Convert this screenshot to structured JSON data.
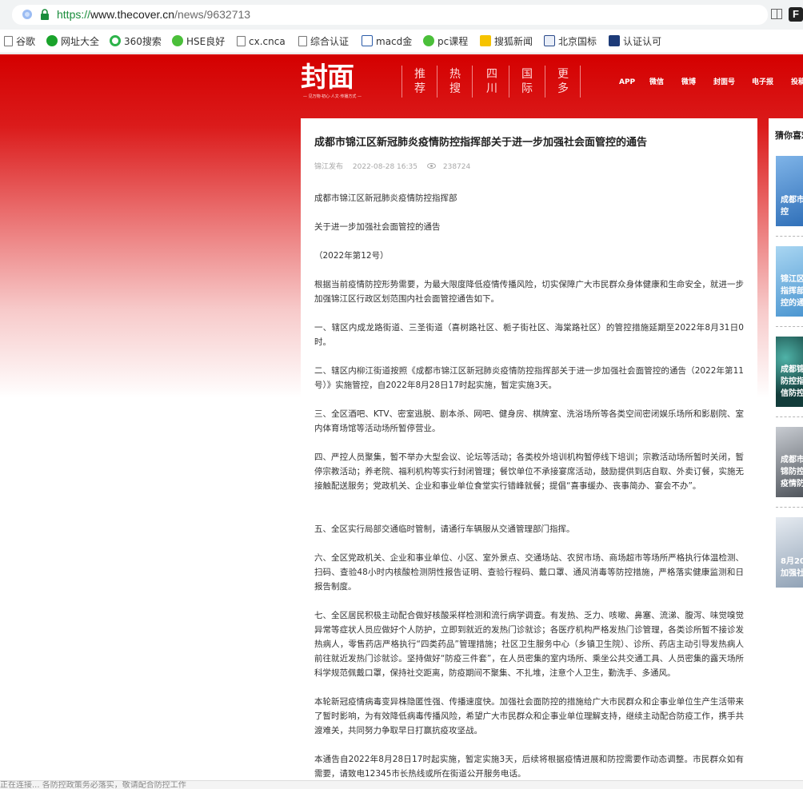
{
  "browser": {
    "url": {
      "scheme": "https://",
      "host": "www.thecover.cn",
      "path": "/news/9632713"
    },
    "extension_label": "F"
  },
  "bookmarks": [
    {
      "label": "谷歌",
      "icon": "page-icon"
    },
    {
      "label": "网址大全",
      "icon": "green-plus-icon"
    },
    {
      "label": "360搜索",
      "icon": "circle-search-icon"
    },
    {
      "label": "HSE良好",
      "icon": "wechat-icon"
    },
    {
      "label": "cx.cnca",
      "icon": "page-icon"
    },
    {
      "label": "综合认证",
      "icon": "page-icon"
    },
    {
      "label": "macd金",
      "icon": "macd-icon"
    },
    {
      "label": "pc课程",
      "icon": "wechat-icon"
    },
    {
      "label": "搜狐新闻",
      "icon": "sohu-icon"
    },
    {
      "label": "北京国标",
      "icon": "bj-icon"
    },
    {
      "label": "认证认可",
      "icon": "cert-icon"
    }
  ],
  "site": {
    "logo": "封面",
    "logo_slogan": "— 见万物·初心·人文·传播方式 —",
    "nav": [
      {
        "line1": "推",
        "line2": "荐"
      },
      {
        "line1": "热",
        "line2": "搜"
      },
      {
        "line1": "四",
        "line2": "川"
      },
      {
        "line1": "国",
        "line2": "际"
      },
      {
        "line1": "更",
        "line2": "多"
      }
    ],
    "top_links": [
      "APP",
      "微信",
      "微博",
      "封面号",
      "电子报",
      "投稿"
    ]
  },
  "article": {
    "title": "成都市锦江区新冠肺炎疫情防控指挥部关于进一步加强社会面管控的通告",
    "source": "锦江发布",
    "datetime": "2022-08-28 16:35",
    "views": "238724",
    "paragraphs": [
      "成都市锦江区新冠肺炎疫情防控指挥部",
      "关于进一步加强社会面管控的通告",
      "（2022年第12号）",
      "根据当前疫情防控形势需要，为最大限度降低疫情传播风险，切实保障广大市民群众身体健康和生命安全，就进一步加强锦江区行政区划范围内社会面管控通告如下。",
      "一、辖区内成龙路街道、三圣街道（喜树路社区、栀子街社区、海棠路社区）的管控措施延期至2022年8月31日0时。",
      "二、辖区内柳江街道按照《成都市锦江区新冠肺炎疫情防控指挥部关于进一步加强社会面管控的通告（2022年第11号）》实施管控，自2022年8月28日17时起实施，暂定实施3天。",
      "三、全区酒吧、KTV、密室逃脱、剧本杀、网吧、健身房、棋牌室、洗浴场所等各类空间密闭娱乐场所和影剧院、室内体育场馆等活动场所暂停营业。",
      "四、严控人员聚集，暂不举办大型会议、论坛等活动；各类校外培训机构暂停线下培训；宗教活动场所暂时关闭，暂停宗教活动；养老院、福利机构等实行封闭管理；餐饮单位不承接宴席活动，鼓励提供到店自取、外卖订餐，实施无接触配送服务；党政机关、企业和事业单位食堂实行错峰就餐；提倡“喜事缓办、丧事简办、宴会不办”。",
      "五、全区实行局部交通临时管制，请通行车辆服从交通管理部门指挥。",
      "六、全区党政机关、企业和事业单位、小区、室外景点、交通场站、农贸市场、商场超市等场所严格执行体温检测、扫码、查验48小时内核酸检测阴性报告证明、查验行程码、戴口罩、通风消毒等防控措施，严格落实健康监测和日报告制度。",
      "七、全区居民积极主动配合做好核酸采样检测和流行病学调查。有发热、乏力、咳嗽、鼻塞、流涕、腹泻、味觉嗅觉异常等症状人员应做好个人防护，立即到就近的发热门诊就诊；各医疗机构严格发热门诊管理，各类诊所暂不接诊发热病人，零售药店严格执行“四类药品”管理措施；社区卫生服务中心（乡镇卫生院）、诊所、药店主动引导发热病人前往就近发热门诊就诊。坚持做好“防疫三件套”，在人员密集的室内场所、乘坐公共交通工具、人员密集的露天场所科学规范佩戴口罩，保持社交距离，防疫期间不聚集、不扎堆，注意个人卫生，勤洗手、多通风。",
      "本轮新冠疫情病毒变异株隐匿性强、传播速度快。加强社会面防控的措施给广大市民群众和企事业单位生产生活带来了暂时影响，为有效降低病毒传播风险，希望广大市民群众和企事业单位理解支持，继续主动配合防疫工作，携手共渡难关，共同努力争取早日打赢抗疫攻坚战。",
      "本通告自2022年8月28日17时起实施，暂定实施3天，后续将根据疫情进展和防控需要作动态调整。市民群众如有需要，请致电12345市长热线或所在街道公开服务电话。"
    ]
  },
  "sidebar": {
    "title": "猜你喜欢",
    "cards": [
      {
        "caption": "成都市\n控",
        "color": "#3f7fc6"
      },
      {
        "caption": "锦江区\n指挥部\n控的通",
        "color": "#5ea8dd"
      },
      {
        "caption": "成都锦\n防控指\n信防控",
        "color": "#1f5a57"
      },
      {
        "caption": "成都市\n锦防控\n疫情防",
        "color": "#6a6f77"
      },
      {
        "caption": "8月20\n加强社",
        "color": "#b9c3cf"
      }
    ]
  },
  "status": {
    "text": "正在连接... 各防控政策务必落实，敬请配合防控工作"
  }
}
